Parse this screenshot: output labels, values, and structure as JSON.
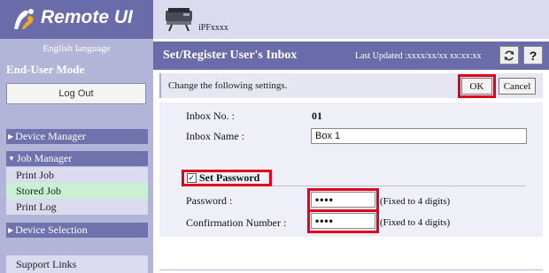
{
  "sidebar": {
    "app_title": "Remote UI",
    "language": "English language",
    "mode": "End-User Mode",
    "logout_label": "Log Out",
    "device_manager": "Device Manager",
    "job_manager": "Job Manager",
    "job_items": [
      "Print Job",
      "Stored Job",
      "Print Log"
    ],
    "device_selection": "Device Selection",
    "support_links": "Support Links"
  },
  "header": {
    "printer_name": "iPFxxxx",
    "page_title": "Set/Register User's Inbox",
    "last_updated": "Last Updated :xxxx/xx/xx xx:xx:xx",
    "refresh_icon": "refresh-icon",
    "help_label": "?"
  },
  "form": {
    "instruction": "Change the following settings.",
    "ok_label": "OK",
    "cancel_label": "Cancel",
    "inbox_no_label": "Inbox No. :",
    "inbox_no_value": "01",
    "inbox_name_label": "Inbox Name :",
    "inbox_name_value": "Box 1",
    "set_password_label": "Set Password",
    "set_password_checked": true,
    "password_label": "Password :",
    "password_value": "••••",
    "password_note": "(Fixed to 4 digits)",
    "confirm_label": "Confirmation Number :",
    "confirm_value": "••••",
    "confirm_note": "(Fixed to 4 digits)"
  },
  "colors": {
    "sidebar_bg": "#b3b5d8",
    "header_dark": "#6a6caa",
    "highlight": "#e3001b",
    "active_item": "#c8f0d2"
  }
}
